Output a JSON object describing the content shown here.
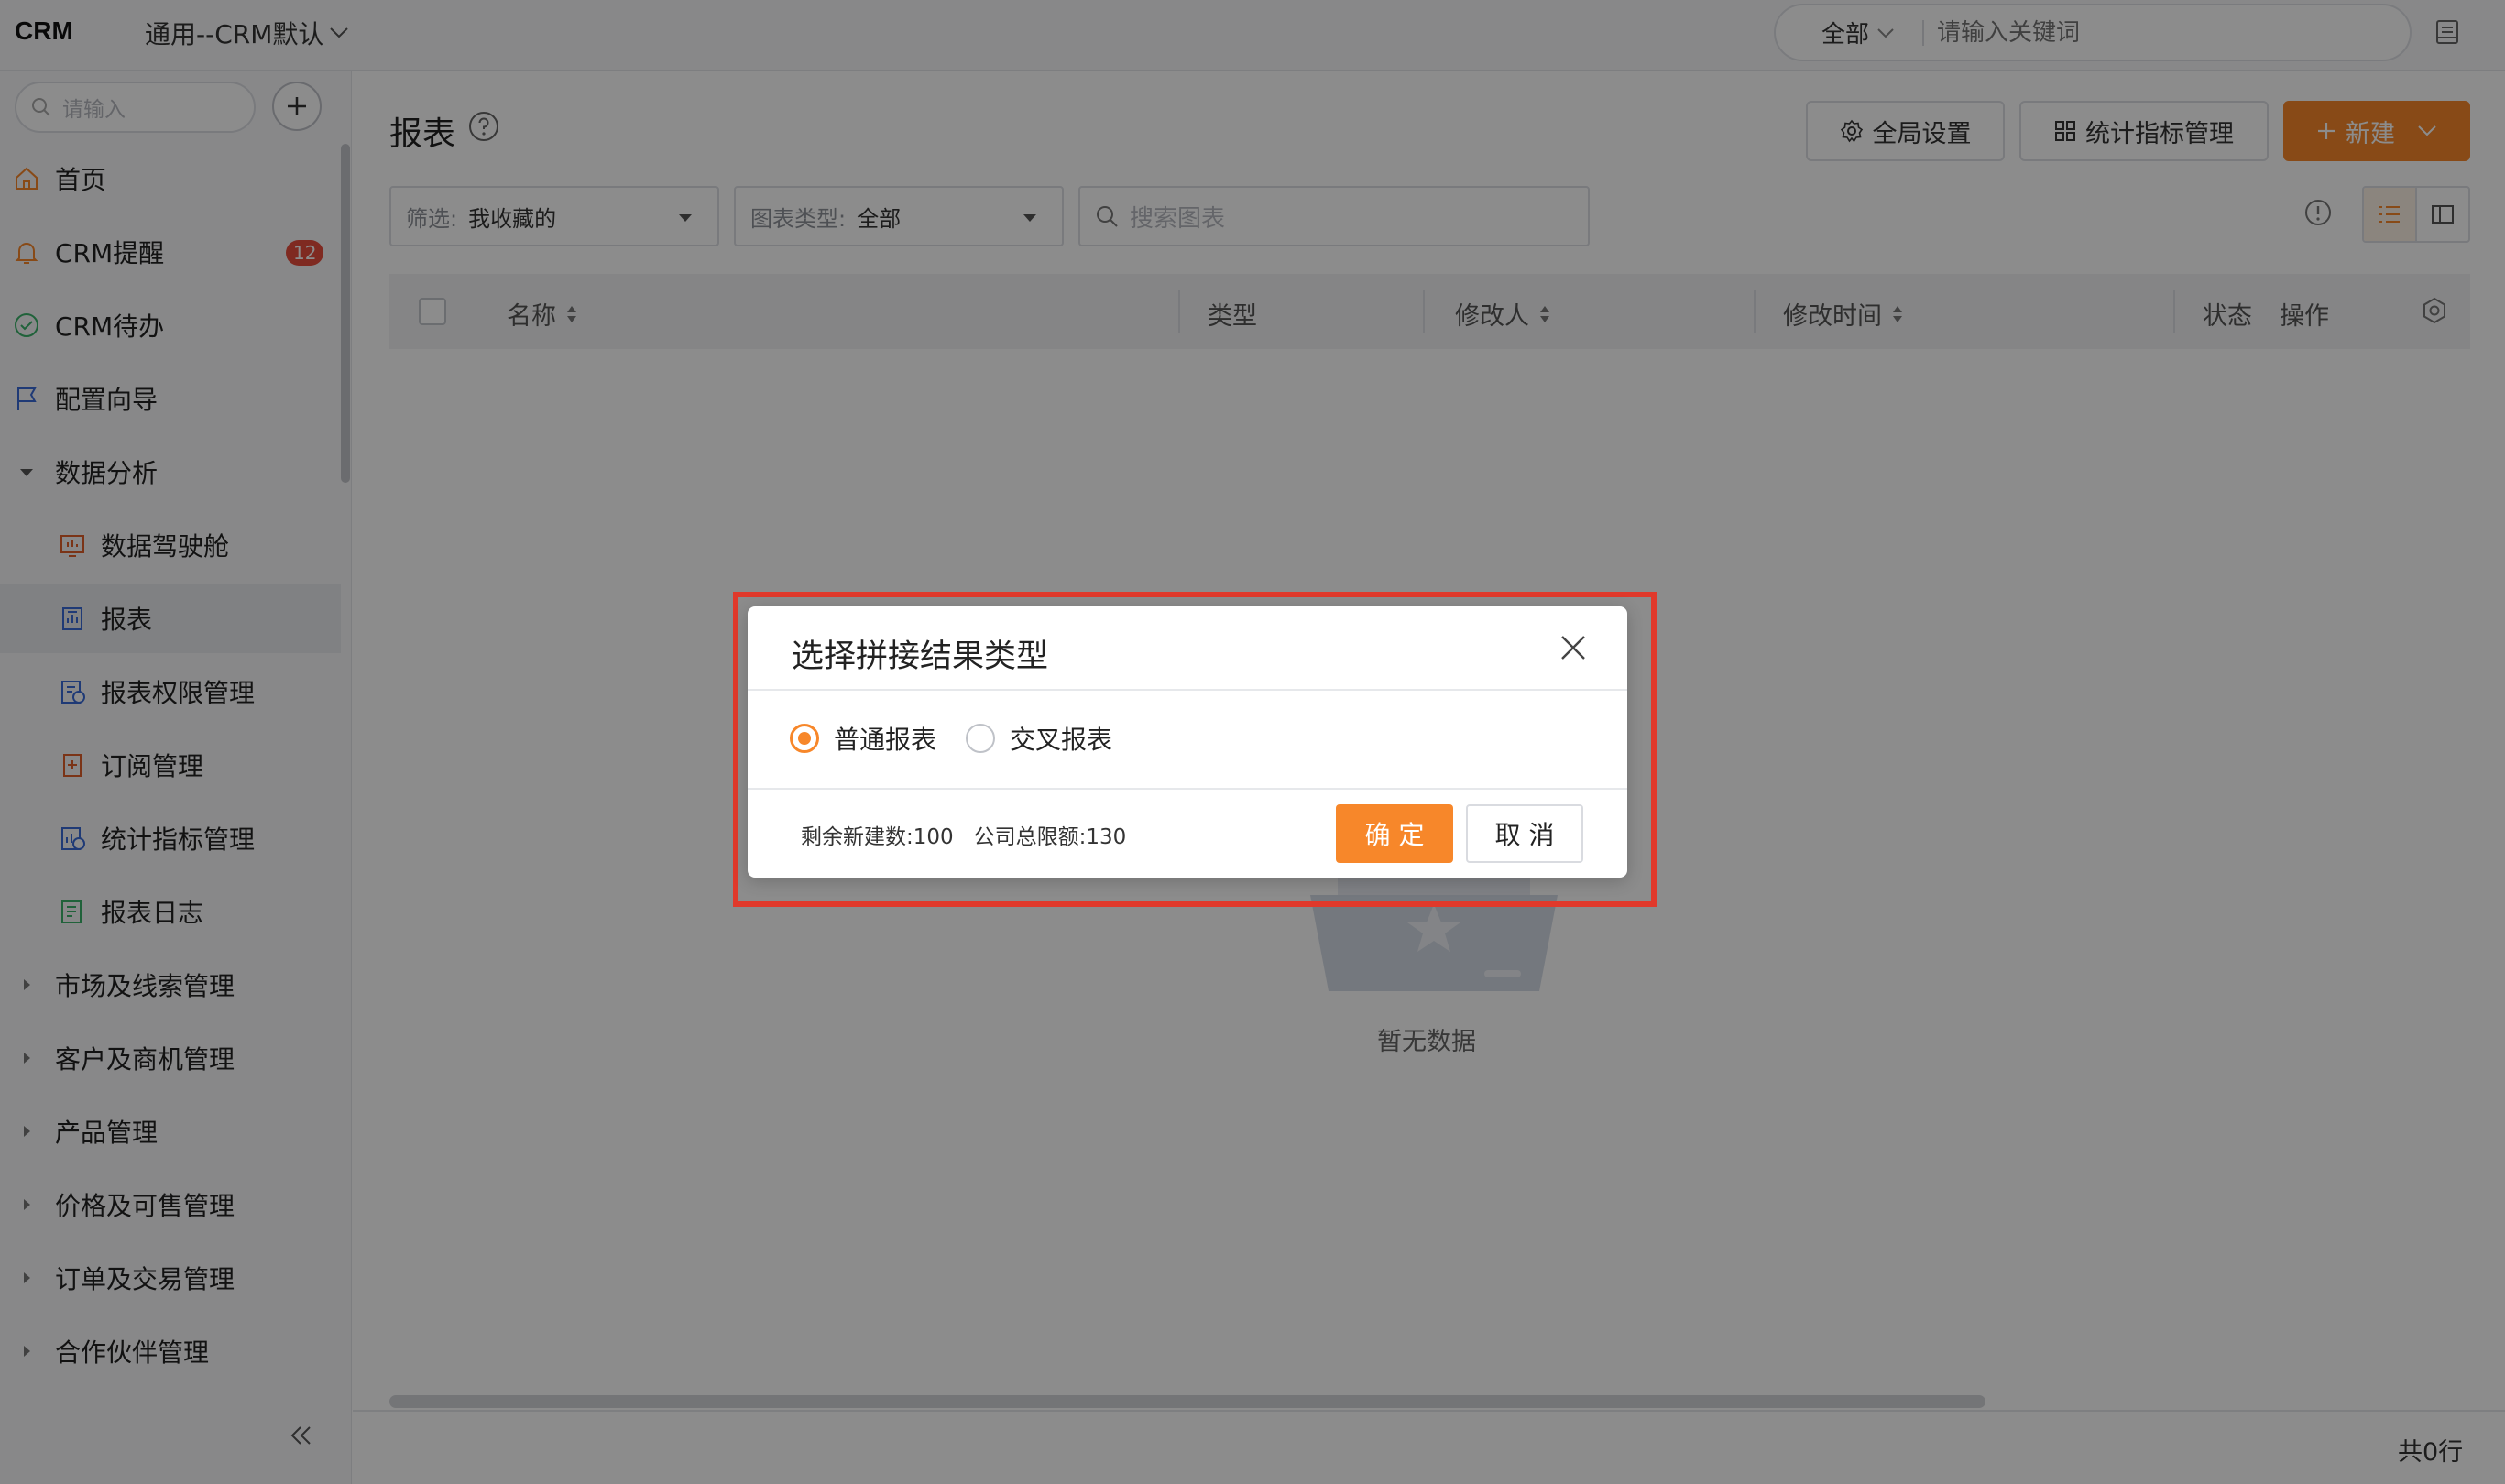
{
  "topbar": {
    "app_name": "CRM",
    "app_switcher": "通用--CRM默认",
    "search_scope": "全部",
    "search_placeholder": "请输入关键词"
  },
  "sidebar": {
    "search_placeholder": "请输入",
    "items": [
      {
        "label": "首页",
        "icon": "home-icon"
      },
      {
        "label": "CRM提醒",
        "icon": "bell-icon",
        "badge": "12"
      },
      {
        "label": "CRM待办",
        "icon": "check-circle-icon"
      },
      {
        "label": "配置向导",
        "icon": "flag-icon"
      },
      {
        "label": "数据分析",
        "icon": "caret-down-icon",
        "expanded": true
      },
      {
        "label": "数据驾驶舱",
        "icon": "dashboard-icon"
      },
      {
        "label": "报表",
        "icon": "report-icon",
        "active": true
      },
      {
        "label": "报表权限管理",
        "icon": "report-permission-icon"
      },
      {
        "label": "订阅管理",
        "icon": "subscription-icon"
      },
      {
        "label": "统计指标管理",
        "icon": "metric-icon"
      },
      {
        "label": "报表日志",
        "icon": "log-icon"
      },
      {
        "label": "市场及线索管理",
        "icon": "caret-right-icon"
      },
      {
        "label": "客户及商机管理",
        "icon": "caret-right-icon"
      },
      {
        "label": "产品管理",
        "icon": "caret-right-icon"
      },
      {
        "label": "价格及可售管理",
        "icon": "caret-right-icon"
      },
      {
        "label": "订单及交易管理",
        "icon": "caret-right-icon"
      },
      {
        "label": "合作伙伴管理",
        "icon": "caret-right-icon"
      }
    ]
  },
  "main": {
    "title": "报表",
    "buttons": {
      "global_settings": "全局设置",
      "metric_management": "统计指标管理",
      "new": "新建"
    },
    "filters": {
      "filter_label": "筛选:",
      "filter_value": "我收藏的",
      "type_label": "图表类型:",
      "type_value": "全部",
      "search_placeholder": "搜索图表"
    },
    "table": {
      "columns": [
        "名称",
        "类型",
        "修改人",
        "修改时间",
        "状态",
        "操作"
      ],
      "empty_text": "暂无数据"
    },
    "row_count": "共0行"
  },
  "dialog": {
    "title": "选择拼接结果类型",
    "options": [
      {
        "label": "普通报表",
        "selected": true
      },
      {
        "label": "交叉报表",
        "selected": false
      }
    ],
    "remaining_quota": "剩余新建数:100",
    "total_quota": "公司总限额:130",
    "confirm": "确 定",
    "cancel": "取 消"
  },
  "colors": {
    "accent": "#f7872a",
    "highlight_border": "#e0392b",
    "badge": "#e84d3d"
  }
}
